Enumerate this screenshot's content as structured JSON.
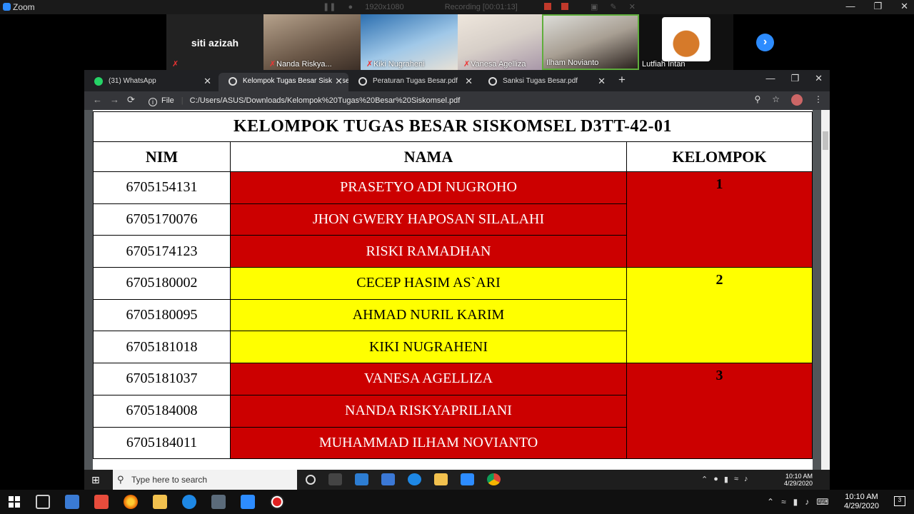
{
  "zoom": {
    "app_title": "Zoom",
    "resolution": "1920x1080",
    "recording": "Recording [00:01:13]"
  },
  "participants": [
    {
      "name": "siti azizah",
      "muted": true
    },
    {
      "name": "Nanda Riskya...",
      "muted": true
    },
    {
      "name": "Kiki Nugraheni",
      "muted": true
    },
    {
      "name": "Vanesa Agelliza",
      "muted": true
    },
    {
      "name": "Ilham Novianto",
      "muted": false
    },
    {
      "name": "Lutfiah Intan",
      "muted": false
    }
  ],
  "browser": {
    "tabs": [
      {
        "label": "(31) WhatsApp"
      },
      {
        "label": "Kelompok Tugas Besar Siskomsel"
      },
      {
        "label": "Peraturan Tugas Besar.pdf"
      },
      {
        "label": "Sanksi Tugas Besar.pdf"
      }
    ],
    "address_prefix": "File",
    "url": "C:/Users/ASUS/Downloads/Kelompok%20Tugas%20Besar%20Siskomsel.pdf"
  },
  "sheet": {
    "title": "KELOMPOK TUGAS BESAR SISKOMSEL D3TT-42-01",
    "headers": {
      "nim": "NIM",
      "nama": "NAMA",
      "kelompok": "KELOMPOK"
    },
    "rows": [
      {
        "nim": "6705154131",
        "nama": "PRASETYO ADI NUGROHO",
        "color": "#cc0000"
      },
      {
        "nim": "6705170076",
        "nama": "JHON GWERY HAPOSAN SILALAHI",
        "color": "#cc0000"
      },
      {
        "nim": "6705174123",
        "nama": "RISKI RAMADHAN",
        "color": "#cc0000"
      },
      {
        "nim": "6705180002",
        "nama": "CECEP HASIM AS`ARI",
        "color": "#ffff00"
      },
      {
        "nim": "6705180095",
        "nama": "AHMAD NURIL KARIM",
        "color": "#ffff00"
      },
      {
        "nim": "6705181018",
        "nama": "KIKI NUGRAHENI",
        "color": "#ffff00"
      },
      {
        "nim": "6705181037",
        "nama": "VANESA AGELLIZA",
        "color": "#cc0000"
      },
      {
        "nim": "6705184008",
        "nama": "NANDA RISKYAPRILIANI",
        "color": "#cc0000"
      },
      {
        "nim": "6705184011",
        "nama": "MUHAMMAD ILHAM NOVIANTO",
        "color": "#cc0000"
      }
    ],
    "groups": [
      "1",
      "2",
      "3"
    ]
  },
  "inner_taskbar": {
    "search_placeholder": "Type here to search",
    "time": "10:10 AM",
    "date": "4/29/2020"
  },
  "taskbar": {
    "time": "10:10 AM",
    "date": "4/29/2020"
  }
}
